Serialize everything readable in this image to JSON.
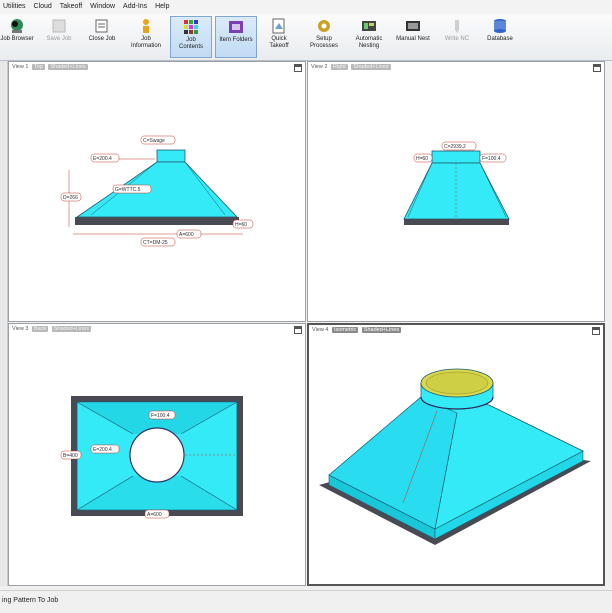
{
  "menu": [
    "Utilities",
    "Cloud",
    "Takeoff",
    "Window",
    "Add-Ins",
    "Help"
  ],
  "toolbar": [
    {
      "label": "Job Browser",
      "icon": "job-browser-icon",
      "state": "normal"
    },
    {
      "label": "Save Job",
      "icon": "save-job-icon",
      "state": "disabled"
    },
    {
      "label": "Close Job",
      "icon": "close-job-icon",
      "state": "normal"
    },
    {
      "label": "Job\nInformation",
      "icon": "job-information-icon",
      "state": "normal"
    },
    {
      "label": "Job\nContents",
      "icon": "job-contents-icon",
      "state": "active"
    },
    {
      "label": "Item Folders",
      "icon": "item-folders-icon",
      "state": "active"
    },
    {
      "label": "Quick\nTakeoff",
      "icon": "quick-takeoff-icon",
      "state": "normal"
    },
    {
      "label": "Setup\nProcesses",
      "icon": "setup-processes-icon",
      "state": "normal"
    },
    {
      "label": "Automatic\nNesting",
      "icon": "automatic-nesting-icon",
      "state": "normal"
    },
    {
      "label": "Manual Nest",
      "icon": "manual-nest-icon",
      "state": "normal"
    },
    {
      "label": "Write NC",
      "icon": "write-nc-icon",
      "state": "disabled"
    },
    {
      "label": "Database",
      "icon": "database-icon",
      "state": "normal"
    }
  ],
  "views": [
    {
      "title": "View 1",
      "orientation": "Top",
      "mode": "Shaded+Lines",
      "dims": {
        "c": "C=Swage",
        "e": "E=200.4",
        "d": "D=266",
        "g": "G=WTTC.5",
        "h": "H=60",
        "a": "A=600",
        "ct": "CT=DM-25"
      }
    },
    {
      "title": "View 2",
      "orientation": "Right",
      "mode": "Shaded+Lines",
      "dims": {
        "c": "C=2939.2",
        "h": "H=60",
        "f": "F=100.4"
      }
    },
    {
      "title": "View 3",
      "orientation": "Back",
      "mode": "Shaded+Lines",
      "dims": {
        "f": "F=100.4",
        "e": "E=200.4",
        "b": "B=400",
        "a": "A=600"
      }
    },
    {
      "title": "View 4",
      "orientation": "Isometric",
      "mode": "Shaded+Lines"
    }
  ],
  "status": "ing Pattern To Job",
  "colors": {
    "fill": "#33eaf6",
    "fill_dark": "#18c7d8",
    "flange": "#4a4a52",
    "collar_top": "#d8d84a",
    "dim_line": "#c0392b"
  }
}
